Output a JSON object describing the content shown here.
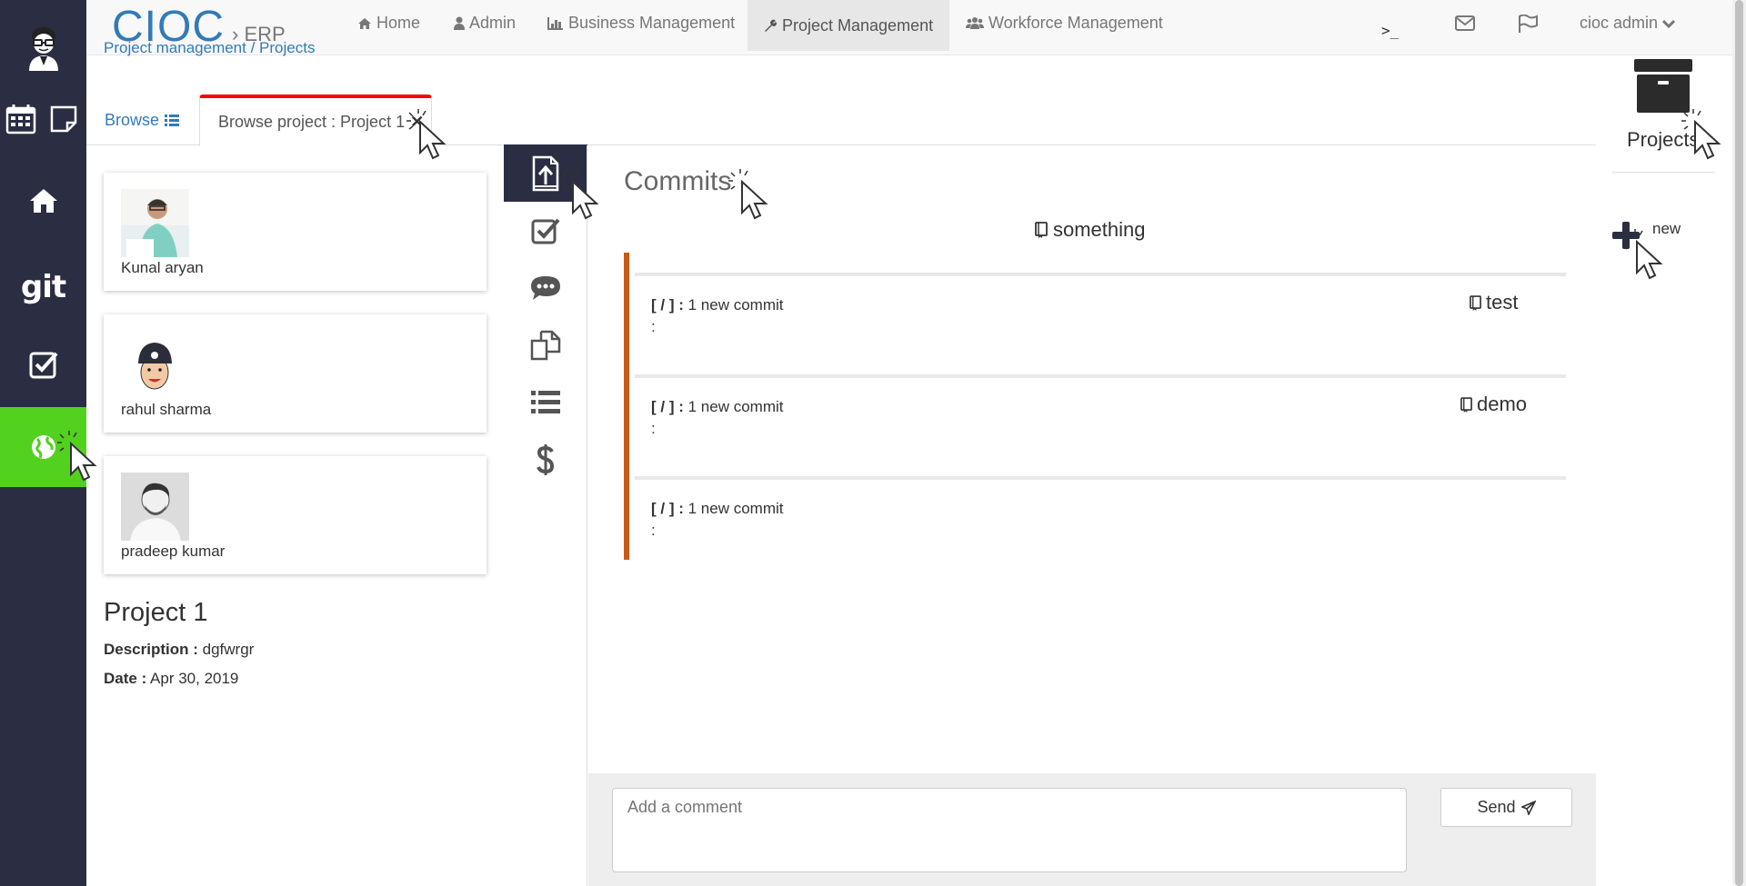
{
  "navbar": {
    "brand": "CIOC",
    "brand_sub": "ERP",
    "items": [
      {
        "label": "Home",
        "icon": "home-icon"
      },
      {
        "label": "Admin",
        "icon": "user-icon"
      },
      {
        "label": "Business Management",
        "icon": "bar-chart-icon"
      },
      {
        "label": "Project Management",
        "icon": "wrench-icon"
      },
      {
        "label": "Workforce Management",
        "icon": "users-icon"
      }
    ],
    "active": "Project Management",
    "terminal": ">_",
    "user": "cioc admin"
  },
  "sidebar": {
    "items": [
      "avatar",
      "calendar-icon",
      "note-icon",
      "home-icon",
      "git",
      "checkbox-icon",
      "globe-icon"
    ],
    "git_label": "git",
    "active": "globe-icon"
  },
  "breadcrumb": {
    "text": "Project management / Projects"
  },
  "tabs": {
    "browse": "Browse",
    "project": "Browse project : Project 1"
  },
  "members": [
    {
      "name": "Kunal aryan"
    },
    {
      "name": "rahul sharma"
    },
    {
      "name": "pradeep kumar"
    }
  ],
  "project": {
    "title": "Project 1",
    "description_label": "Description :",
    "description": "dgfwrgr",
    "date_label": "Date :",
    "date": "Apr 30, 2019"
  },
  "commits": {
    "title": "Commits",
    "repo": "something",
    "items": [
      {
        "path": "[ / ] :",
        "message": "1 new commit",
        "colon": ":",
        "repo": "test"
      },
      {
        "path": "[ / ] :",
        "message": "1 new commit",
        "colon": ":",
        "repo": "demo"
      },
      {
        "path": "[ / ] :",
        "message": "1 new commit",
        "colon": ":",
        "repo": ""
      }
    ]
  },
  "comment": {
    "placeholder": "Add a comment",
    "send_label": "Send"
  },
  "right_panel": {
    "projects_label": "Projects",
    "new_label": "new"
  },
  "colors": {
    "sidebar": "#2b2d42",
    "sidebar_active": "#52d11e",
    "brand": "#337ab7",
    "tab_active_border": "#ff0000",
    "commit_border": "#c85a19"
  }
}
